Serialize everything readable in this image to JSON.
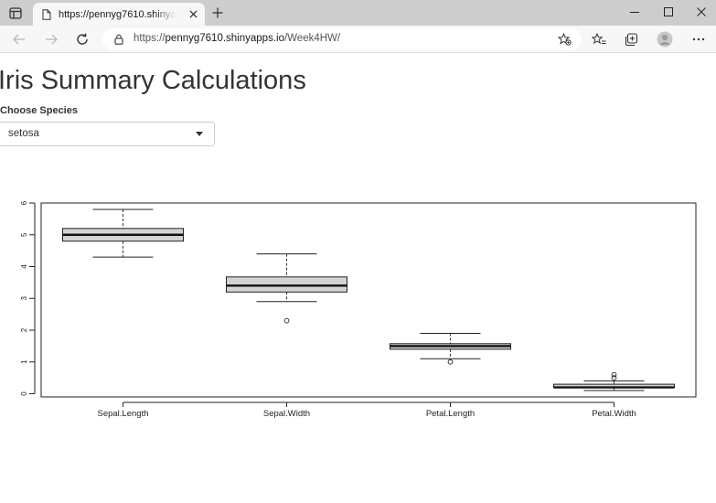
{
  "browser": {
    "tab_title": "https://pennyg7610.shinyapps.io/Week4HW/",
    "url_scheme": "https://",
    "url_host": "pennyg7610.shinyapps.io",
    "url_path": "/Week4HW/"
  },
  "page": {
    "title": "Iris Summary Calculations",
    "select_label": "Choose Species",
    "selected_species": "setosa"
  },
  "chart_data": {
    "type": "boxplot",
    "categories": [
      "Sepal.Length",
      "Sepal.Width",
      "Petal.Length",
      "Petal.Width"
    ],
    "boxes": [
      {
        "name": "Sepal.Length",
        "whisker_low": 4.3,
        "q1": 4.8,
        "median": 5.0,
        "q3": 5.2,
        "whisker_high": 5.8,
        "outliers": []
      },
      {
        "name": "Sepal.Width",
        "whisker_low": 2.9,
        "q1": 3.2,
        "median": 3.4,
        "q3": 3.675,
        "whisker_high": 4.4,
        "outliers": [
          2.3
        ]
      },
      {
        "name": "Petal.Length",
        "whisker_low": 1.1,
        "q1": 1.4,
        "median": 1.5,
        "q3": 1.575,
        "whisker_high": 1.9,
        "outliers": [
          1.0
        ]
      },
      {
        "name": "Petal.Width",
        "whisker_low": 0.1,
        "q1": 0.2,
        "median": 0.2,
        "q3": 0.3,
        "whisker_high": 0.4,
        "outliers": [
          0.5,
          0.6
        ]
      }
    ],
    "y_ticks": [
      0,
      1,
      2,
      3,
      4,
      5,
      6
    ],
    "ylim": [
      -0.1,
      6.0
    ],
    "box_fill": "#d3d3d3",
    "grid": false
  }
}
